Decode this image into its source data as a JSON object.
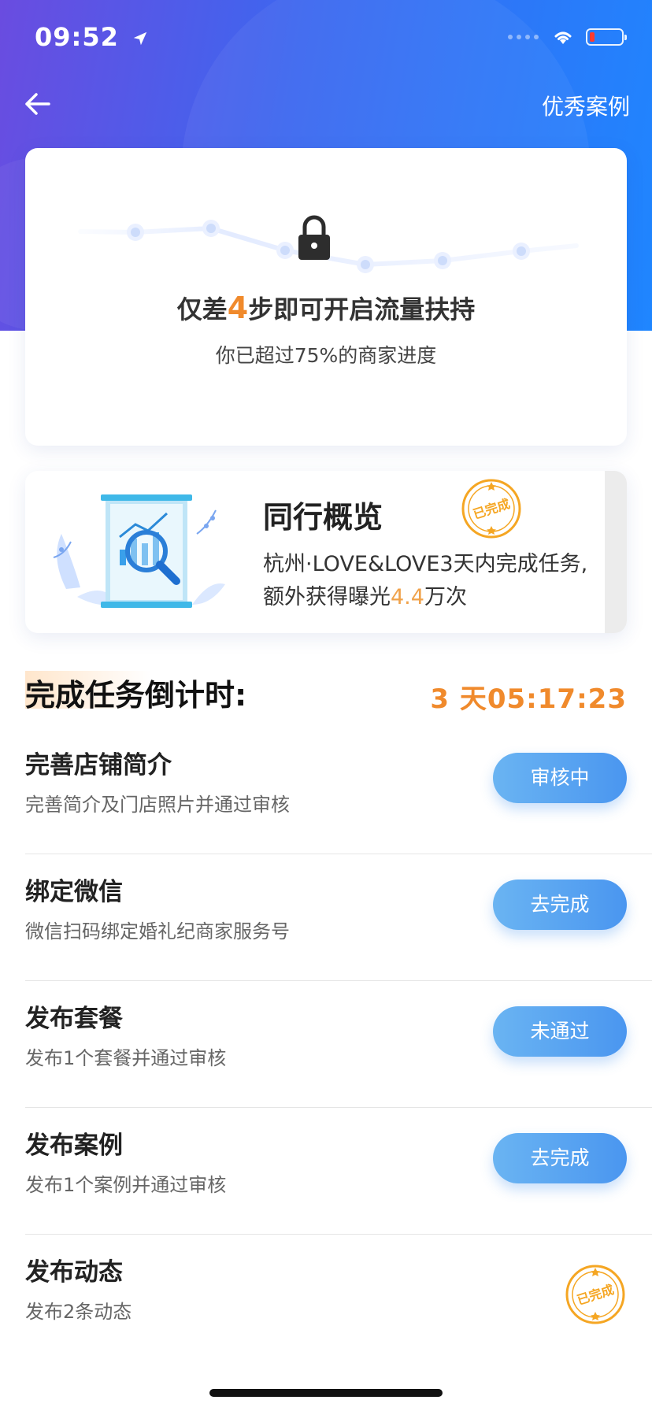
{
  "status_bar": {
    "time": "09:52"
  },
  "nav": {
    "right_link": "优秀案例"
  },
  "progress_card": {
    "title_prefix": "仅差",
    "title_number": "4",
    "title_suffix": "步即可开启流量扶持",
    "subtitle": "你已超过75%的商家进度"
  },
  "overview_card": {
    "title": "同行概览",
    "line1": "杭州·LOVE&LOVE3天内完成任务,",
    "line2_prefix": "额外获得曝光",
    "line2_highlight": "4.4",
    "line2_suffix": "万次",
    "stamp_text": "已完成"
  },
  "countdown": {
    "label": "完成任务倒计时:",
    "timer": "3 天05:17:23"
  },
  "tasks": [
    {
      "title": "完善店铺简介",
      "desc": "完善简介及门店照片并通过审核",
      "action": "审核中"
    },
    {
      "title": "绑定微信",
      "desc": "微信扫码绑定婚礼纪商家服务号",
      "action": "去完成"
    },
    {
      "title": "发布套餐",
      "desc": "发布1个套餐并通过审核",
      "action": "未通过"
    },
    {
      "title": "发布案例",
      "desc": "发布1个案例并通过审核",
      "action": "去完成"
    },
    {
      "title": "发布动态",
      "desc": "发布2条动态",
      "stamp_text": "已完成"
    }
  ],
  "colors": {
    "accent_orange": "#f08a2c",
    "button_blue": "#4a96f0",
    "hero_start": "#6a4ce0",
    "hero_end": "#1f86ff",
    "stamp_gold": "#f5a623"
  },
  "icons": [
    "location-arrow-icon",
    "wifi-icon",
    "battery-icon",
    "back-arrow-icon",
    "lock-icon"
  ]
}
